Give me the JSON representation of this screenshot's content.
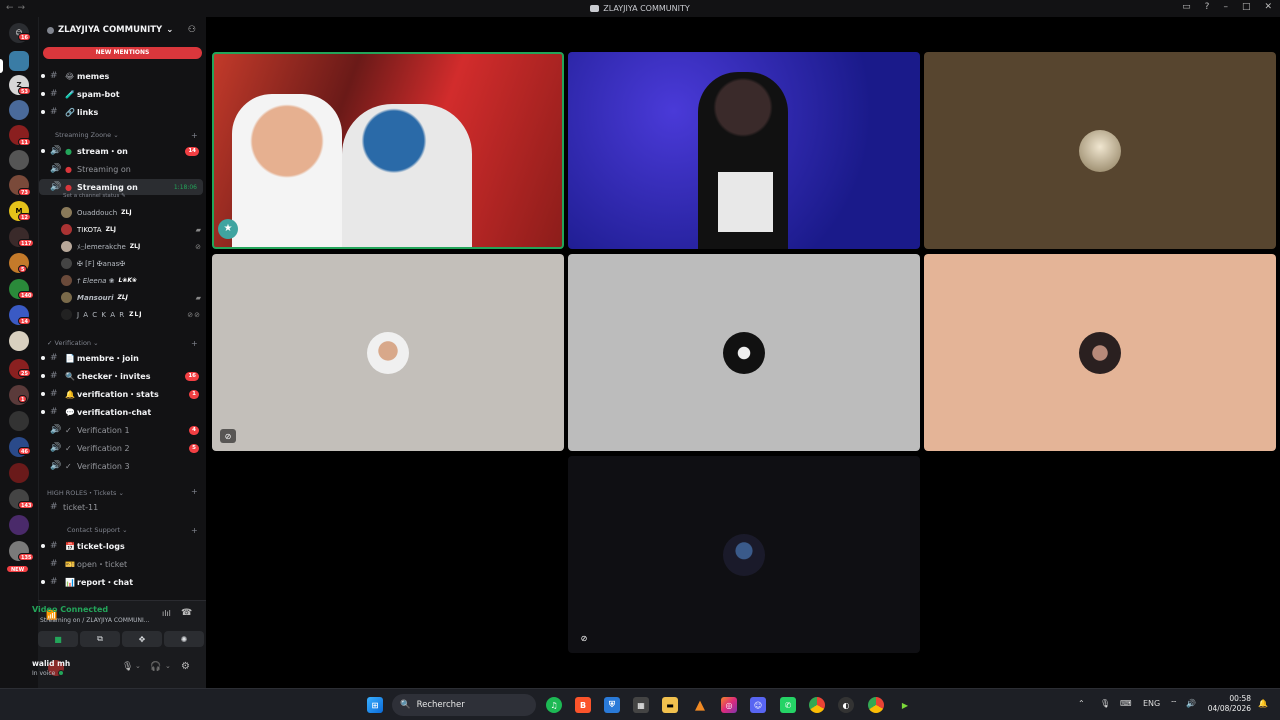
{
  "window": {
    "title": "ZLAYJIYA COMMUNITY"
  },
  "guild_badges": [
    "16",
    "53",
    "11",
    "73",
    "12",
    "117",
    "5",
    "140",
    "14",
    "25",
    "1",
    "46",
    "143",
    "135"
  ],
  "guild_new_label": "NEW",
  "server": {
    "name": "ZLAYJIYA COMMUNITY"
  },
  "new_mentions": "NEW MENTIONS",
  "channels": {
    "memes": "memes",
    "spam_bot": "spam-bot",
    "links": "links",
    "cat_streaming": "Streaming Zoone",
    "stream_on": "stream・on",
    "stream_on_badge": "14",
    "streaming_on_1": "Streaming on",
    "streaming_on_2": "Streaming on",
    "streaming_timer": "1:18:06",
    "channel_status": "Set a channel status",
    "cat_verification": "Verification",
    "membre_join": "membre・join",
    "checker_invites": "checker・invites",
    "checker_badge": "16",
    "verif_stats": "verification・stats",
    "verif_stats_badge": "1",
    "verif_chat": "verification-chat",
    "verif1": "Verification 1",
    "verif1_badge": "4",
    "verif2": "Verification 2",
    "verif2_badge": "5",
    "verif3": "Verification 3",
    "cat_high": "HIGH ROLES・Tickets",
    "ticket11": "ticket-11",
    "cat_contact": "Contact Support",
    "ticket_logs": "ticket-logs",
    "open_ticket": "open・ticket",
    "report_chat": "report・chat"
  },
  "voice_users": [
    {
      "name": "Ouaddouch",
      "tag": "ZLJ"
    },
    {
      "name": "TIKOTA",
      "tag": "ZLJ"
    },
    {
      "name": "ﾒ۝lemerakche",
      "tag": "ZLJ"
    },
    {
      "name": "✠ [F] ✠anas✠",
      "tag": ""
    },
    {
      "name": "† Eleena ❀",
      "tag": "L❀K❀"
    },
    {
      "name": "Mansouri",
      "tag": "ZLJ"
    },
    {
      "name": "J A C K A R",
      "tag": "ZLJ"
    }
  ],
  "voice_panel": {
    "status": "Video Connected",
    "location": "Streaming on / ZLAYJIYA COMMUNI..."
  },
  "user_panel": {
    "name": "walid mh",
    "status": "In voice"
  },
  "taskbar": {
    "search_placeholder": "Rechercher",
    "lang": "ENG",
    "time": "00:58",
    "date": "04/08/2026"
  },
  "colors": {
    "accent": "#5865f2",
    "danger": "#da373c",
    "online": "#23a55a"
  }
}
